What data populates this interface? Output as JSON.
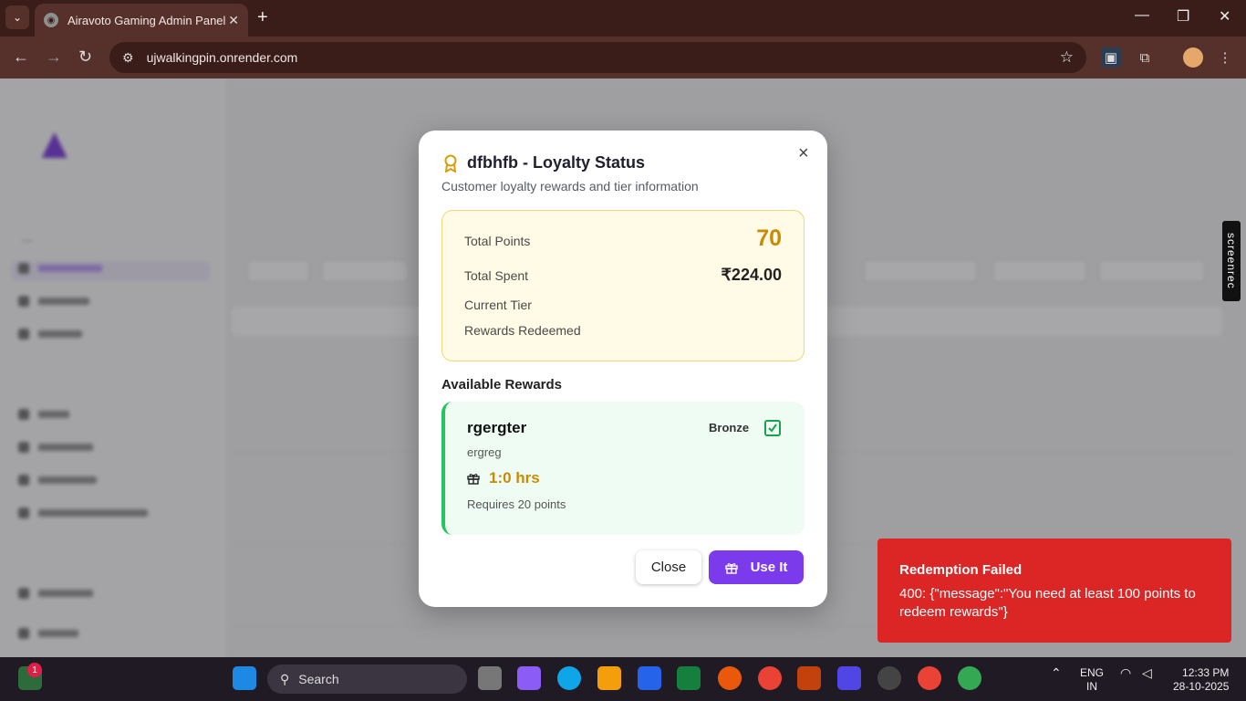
{
  "browser": {
    "tab_title": "Airavoto Gaming Admin Panel",
    "url": "ujwalkingpin.onrender.com"
  },
  "modal": {
    "title": "dfbhfb - Loyalty Status",
    "subtitle": "Customer loyalty rewards and tier information",
    "close_symbol": "×",
    "stats": {
      "total_points_label": "Total Points",
      "total_points": "70",
      "total_spent_label": "Total Spent",
      "total_spent": "₹224.00",
      "current_tier_label": "Current Tier",
      "rewards_redeemed_label": "Rewards Redeemed"
    },
    "available_rewards_label": "Available Rewards",
    "reward": {
      "name": "rgergter",
      "tier": "Bronze",
      "description": "ergreg",
      "duration": "1:0 hrs",
      "requirement": "Requires 20 points"
    },
    "close_button": "Close",
    "use_button": "Use It"
  },
  "toast": {
    "title": "Redemption Failed",
    "message": "400: {\"message\":\"You need at least 100 points to redeem rewards\"}"
  },
  "screenrec_label": "screenrec",
  "taskbar": {
    "search_label": "Search",
    "lang": "ENG",
    "region": "IN",
    "time": "12:33 PM",
    "date": "28-10-2025",
    "notification_count": "1"
  },
  "colors": {
    "accent": "#7c3aed",
    "points": "#c98a06",
    "toast": "#dc2626",
    "reward_border": "#22c55e"
  }
}
